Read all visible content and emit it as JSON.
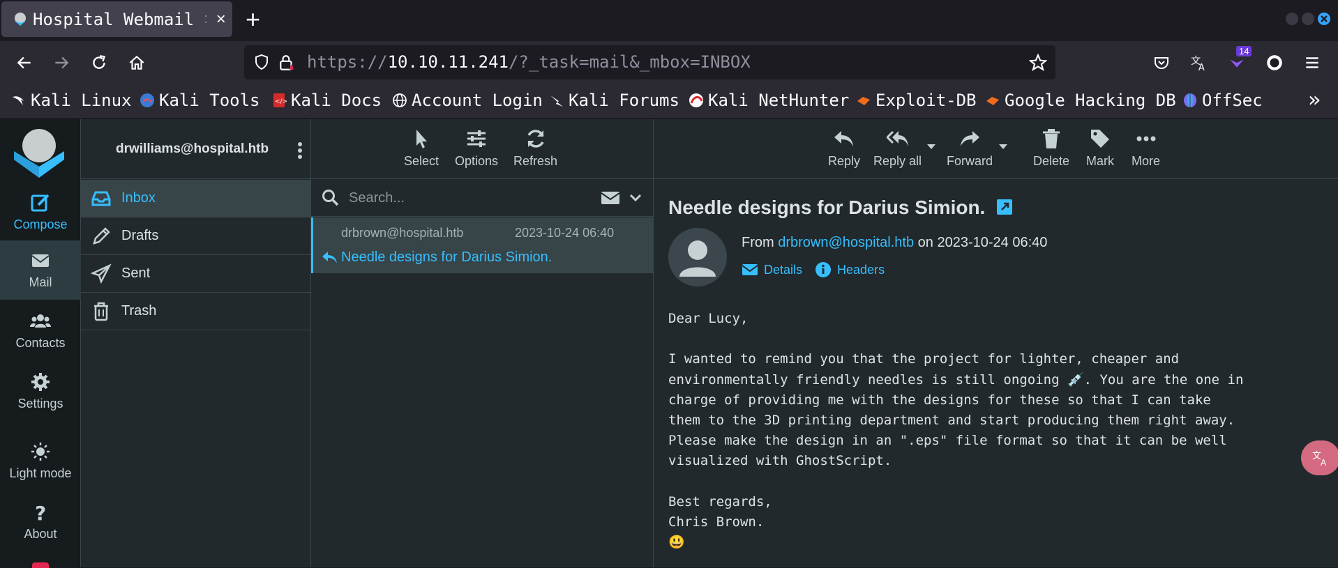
{
  "browser": {
    "tab_title": "Hospital Webmail",
    "tab_separator": ":",
    "tab_close": "×",
    "new_tab": "+",
    "url_prefix": "https://",
    "url_host": "10.10.11.241",
    "url_path": "/?_task=mail&_mbox=INBOX",
    "extension_badge": "14",
    "bookmarks": [
      "Kali Linux",
      "Kali Tools",
      "Kali Docs",
      "Account Login",
      "Kali Forums",
      "Kali NetHunter",
      "Exploit-DB",
      "Google Hacking DB",
      "OffSec"
    ],
    "bookmarks_overflow": "»"
  },
  "nav": {
    "compose": "Compose",
    "mail": "Mail",
    "contacts": "Contacts",
    "settings": "Settings",
    "light_mode": "Light mode",
    "about": "About"
  },
  "folders": {
    "user": "drwilliams@hospital.htb",
    "items": [
      "Inbox",
      "Drafts",
      "Sent",
      "Trash"
    ]
  },
  "list_toolbar": {
    "select": "Select",
    "options": "Options",
    "refresh": "Refresh"
  },
  "search": {
    "placeholder": "Search..."
  },
  "messages": [
    {
      "from": "drbrown@hospital.htb",
      "date": "2023-10-24 06:40",
      "subject": "Needle designs for Darius Simion."
    }
  ],
  "reader_toolbar": {
    "reply": "Reply",
    "reply_all": "Reply all",
    "forward": "Forward",
    "delete": "Delete",
    "mark": "Mark",
    "more": "More"
  },
  "message": {
    "subject": "Needle designs for Darius Simion.",
    "from_label": "From",
    "from": "drbrown@hospital.htb",
    "on_label": "on",
    "date": "2023-10-24 06:40",
    "details": "Details",
    "headers": "Headers",
    "body": "Dear Lucy,\n\nI wanted to remind you that the project for lighter, cheaper and\nenvironmentally friendly needles is still ongoing 💉. You are the one in\ncharge of providing me with the designs for these so that I can take\nthem to the 3D printing department and start producing them right away.\nPlease make the design in an \".eps\" file format so that it can be well\nvisualized with GhostScript.\n\nBest regards,\nChris Brown.\n😃"
  },
  "colors": {
    "accent": "#37beff",
    "bg": "#21292c",
    "nav_bg": "#161b1d",
    "selected_row": "#374549"
  }
}
